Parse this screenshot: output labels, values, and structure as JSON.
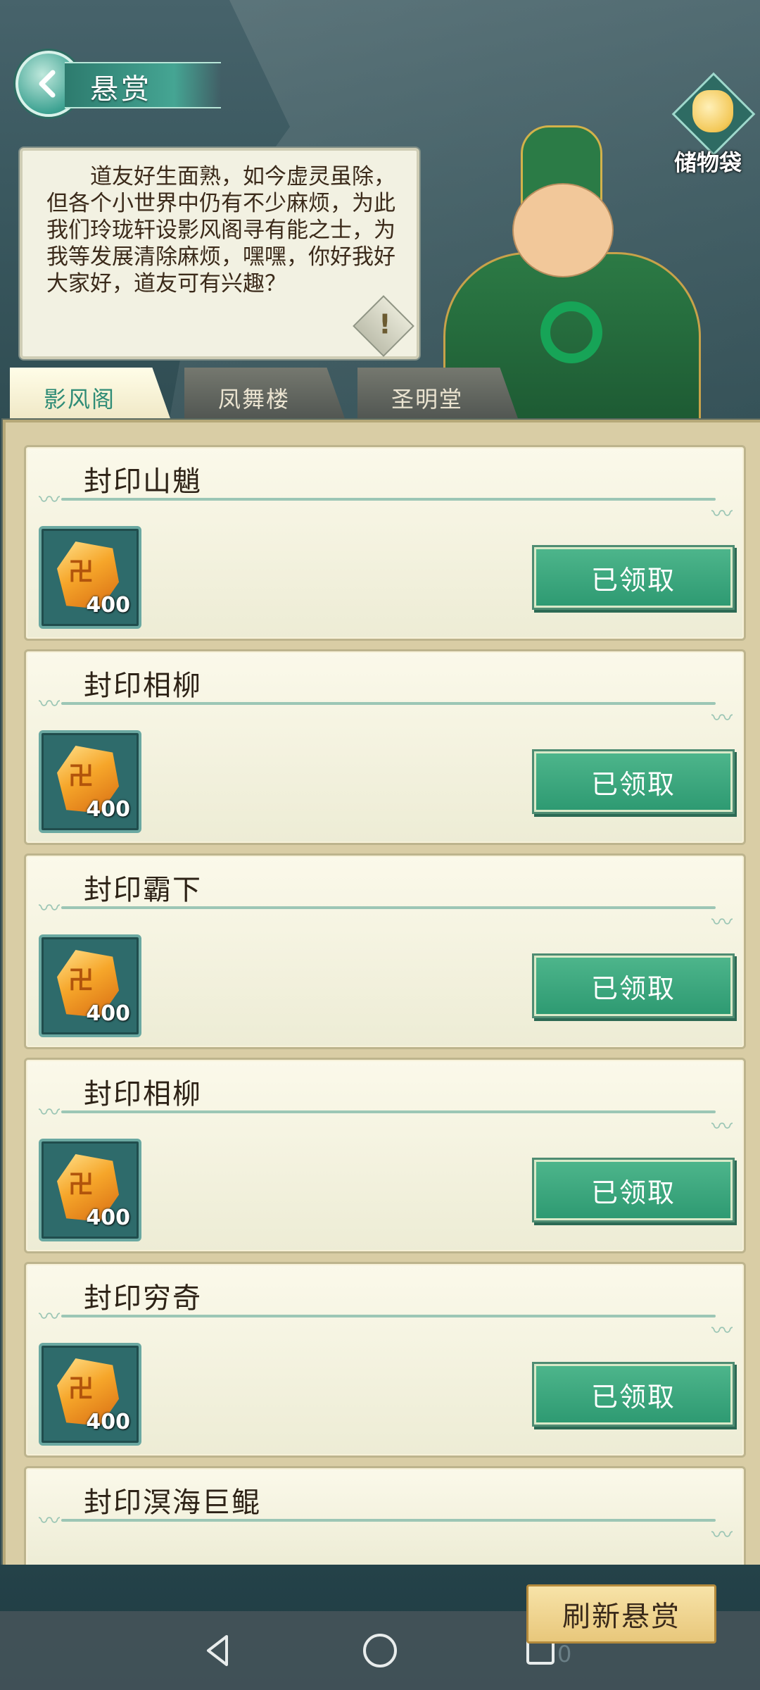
{
  "header": {
    "title": "悬赏",
    "storage_label": "储物袋"
  },
  "dialog": {
    "text": "道友好生面熟，如今虚灵虽除，但各个小世界中仍有不少麻烦，为此我们玲珑轩设影风阁寻有能之士，为我等发展清除麻烦，嘿嘿，你好我好大家好，道友可有兴趣？"
  },
  "tabs": [
    {
      "label": "影风阁",
      "active": true
    },
    {
      "label": "凤舞楼",
      "active": false
    },
    {
      "label": "圣明堂",
      "active": false
    }
  ],
  "bounties": [
    {
      "name": "封印山魈",
      "reward_qty": "400",
      "button": "已领取"
    },
    {
      "name": "封印相柳",
      "reward_qty": "400",
      "button": "已领取"
    },
    {
      "name": "封印霸下",
      "reward_qty": "400",
      "button": "已领取"
    },
    {
      "name": "封印相柳",
      "reward_qty": "400",
      "button": "已领取"
    },
    {
      "name": "封印穷奇",
      "reward_qty": "400",
      "button": "已领取"
    },
    {
      "name": "封印溟海巨鲲",
      "reward_qty": "",
      "button": ""
    }
  ],
  "footer": {
    "refresh_label": "刷新悬赏",
    "counter": "0"
  },
  "colors": {
    "accent_green": "#2e9a72",
    "card_bg": "#fbf9ea",
    "refresh_gold": "#e8c77b"
  }
}
